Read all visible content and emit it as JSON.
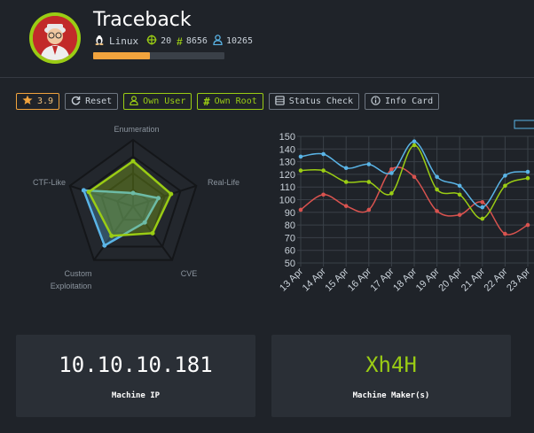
{
  "machine": {
    "name": "Traceback",
    "os": "Linux",
    "points": "20",
    "owns": "8656",
    "users": "10265",
    "progress": 0.43,
    "rating": "3.9"
  },
  "buttons": {
    "reset": "Reset",
    "own_user": "Own User",
    "own_root": "Own Root",
    "status_check": "Status Check",
    "info_card": "Info Card"
  },
  "radar": {
    "labels": {
      "enumeration": "Enumeration",
      "real_life": "Real-Life",
      "cve": "CVE",
      "custom_1": "Custom",
      "custom_2": "Exploitation",
      "ctf_like": "CTF-Like"
    },
    "axes": [
      "Enumeration",
      "Real-Life",
      "CVE",
      "Custom Exploitation",
      "CTF-Like"
    ],
    "series": [
      {
        "color": "#9acc14",
        "values": [
          0.68,
          0.6,
          0.5,
          0.55,
          0.7
        ]
      },
      {
        "color": "#5ab4e6",
        "values": [
          0.2,
          0.4,
          0.3,
          0.73,
          0.78
        ]
      }
    ]
  },
  "chart_data": {
    "type": "line",
    "categories": [
      "13 Apr",
      "14 Apr",
      "15 Apr",
      "16 Apr",
      "17 Apr",
      "18 Apr",
      "19 Apr",
      "20 Apr",
      "21 Apr",
      "22 Apr",
      "23 Apr"
    ],
    "ylim": [
      50,
      150
    ],
    "y_ticks": [
      "150",
      "140",
      "130",
      "120",
      "110",
      "100",
      "90",
      "80",
      "70",
      "60",
      "50"
    ],
    "grid": true,
    "series": [
      {
        "color": "#5ab4e6",
        "values": [
          134,
          136,
          125,
          128,
          121,
          146,
          118,
          111,
          94,
          119,
          122
        ]
      },
      {
        "color": "#9acc14",
        "values": [
          123,
          123,
          114,
          114,
          105,
          143,
          108,
          104,
          85,
          111,
          117
        ]
      },
      {
        "color": "#d9534f",
        "values": [
          92,
          104,
          95,
          92,
          124,
          118,
          91,
          88,
          98,
          73,
          80
        ]
      }
    ]
  },
  "cards": {
    "ip": "10.10.10.181",
    "ip_caption": "Machine IP",
    "maker": "Xh4H",
    "maker_caption": "Machine Maker(s)",
    "maker_color": "#9acc14"
  }
}
